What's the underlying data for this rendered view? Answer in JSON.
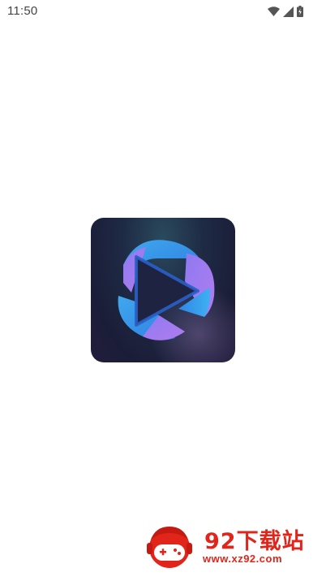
{
  "status_bar": {
    "time": "11:50",
    "icons": [
      "wifi-icon",
      "cell-signal-icon",
      "battery-icon"
    ]
  },
  "splash": {
    "app_icon": "play-button-logo"
  },
  "watermark": {
    "title": "92下载站",
    "url": "www.xz92.com",
    "color": "#e1251b"
  }
}
